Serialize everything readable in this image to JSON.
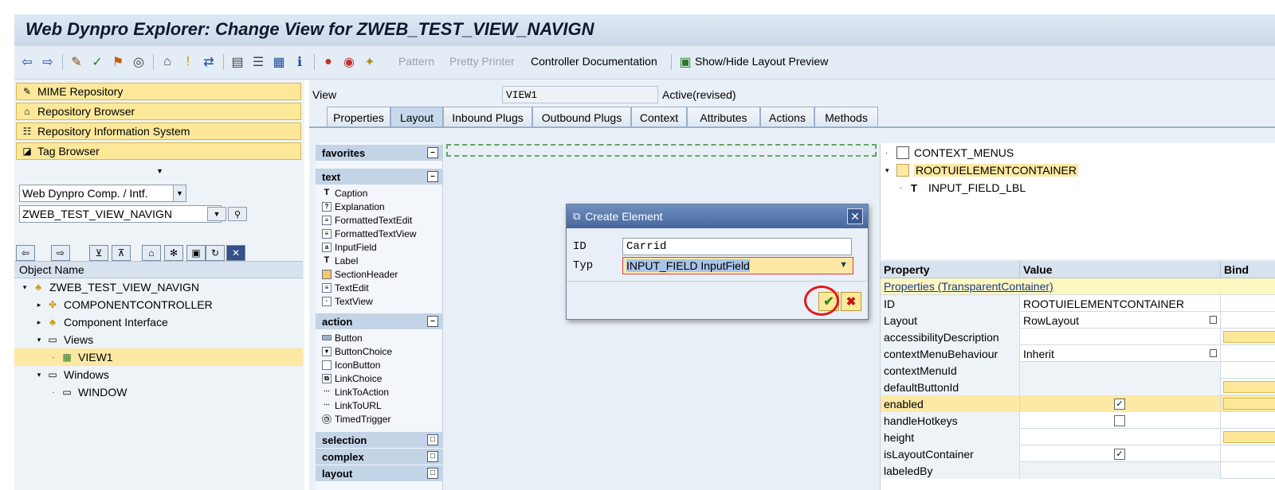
{
  "title": "Web Dynpro Explorer: Change View for ZWEB_TEST_VIEW_NAVIGN",
  "toolbar": {
    "pattern": "Pattern",
    "pretty_printer": "Pretty Printer",
    "controller_doc": "Controller Documentation",
    "show_hide": "Show/Hide Layout Preview"
  },
  "left": {
    "buttons": [
      "MIME Repository",
      "Repository Browser",
      "Repository Information System",
      "Tag Browser"
    ],
    "type_combo": "Web Dynpro Comp. / Intf.",
    "name_combo": "ZWEB_TEST_VIEW_NAVIGN",
    "tree_header": "Object Name",
    "tree": [
      {
        "label": "ZWEB_TEST_VIEW_NAVIGN"
      },
      {
        "label": "COMPONENTCONTROLLER"
      },
      {
        "label": "Component Interface"
      },
      {
        "label": "Views"
      },
      {
        "label": "VIEW1"
      },
      {
        "label": "Windows"
      },
      {
        "label": "WINDOW"
      }
    ]
  },
  "view": {
    "label": "View",
    "name": "VIEW1",
    "status": "Active(revised)"
  },
  "tabs": [
    "Properties",
    "Layout",
    "Inbound Plugs",
    "Outbound Plugs",
    "Context",
    "Attributes",
    "Actions",
    "Methods"
  ],
  "palette": {
    "favorites": "favorites",
    "text": "text",
    "text_items": [
      "Caption",
      "Explanation",
      "FormattedTextEdit",
      "FormattedTextView",
      "InputField",
      "Label",
      "SectionHeader",
      "TextEdit",
      "TextView"
    ],
    "action": "action",
    "action_items": [
      "Button",
      "ButtonChoice",
      "IconButton",
      "LinkChoice",
      "LinkToAction",
      "LinkToURL",
      "TimedTrigger"
    ],
    "selection": "selection",
    "complex": "complex",
    "layout": "layout"
  },
  "right_tree": [
    "CONTEXT_MENUS",
    "ROOTUIELEMENTCONTAINER",
    "INPUT_FIELD_LBL"
  ],
  "props": {
    "col_property": "Property",
    "col_value": "Value",
    "col_bind": "Bind",
    "section": "Properties (TransparentContainer)",
    "rows": [
      {
        "name": "ID",
        "value": "ROOTUIELEMENTCONTAINER"
      },
      {
        "name": "Layout",
        "value": "RowLayout"
      },
      {
        "name": "accessibilityDescription",
        "value": ""
      },
      {
        "name": "contextMenuBehaviour",
        "value": "Inherit"
      },
      {
        "name": "contextMenuId",
        "value": ""
      },
      {
        "name": "defaultButtonId",
        "value": ""
      },
      {
        "name": "enabled",
        "value": "✓"
      },
      {
        "name": "handleHotkeys",
        "value": ""
      },
      {
        "name": "height",
        "value": ""
      },
      {
        "name": "isLayoutContainer",
        "value": "✓"
      },
      {
        "name": "labeledBy",
        "value": ""
      }
    ]
  },
  "dialog": {
    "title": "Create Element",
    "id_label": "ID",
    "id_value": "Carrid",
    "typ_label": "Typ",
    "typ_value": "INPUT_FIELD InputField"
  }
}
